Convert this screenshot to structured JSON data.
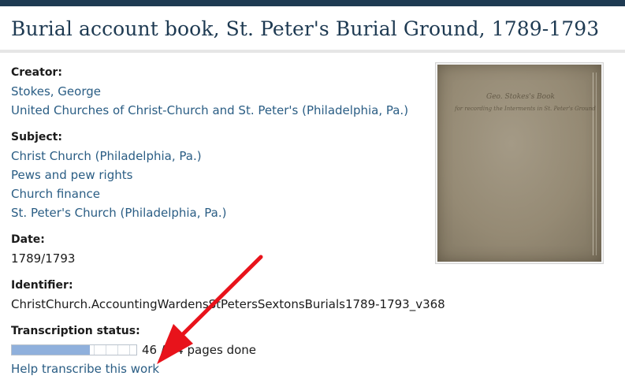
{
  "title": "Burial account book, St. Peter's Burial Ground, 1789-1793",
  "metadata": {
    "creator": {
      "label": "Creator:",
      "items": [
        "Stokes, George",
        "United Churches of Christ-Church and St. Peter's (Philadelphia, Pa.)"
      ]
    },
    "subject": {
      "label": "Subject:",
      "items": [
        "Christ Church (Philadelphia, Pa.)",
        "Pews and pew rights",
        "Church finance",
        "St. Peter's Church (Philadelphia, Pa.)"
      ]
    },
    "date": {
      "label": "Date:",
      "value": "1789/1793"
    },
    "identifier": {
      "label": "Identifier:",
      "value": "ChristChurch.AccountingWardensStPetersSextonsBurials1789-1793_v368"
    },
    "transcription": {
      "label": "Transcription status:",
      "progress_fraction": 0.625,
      "progress_text": "46 / 74 pages done",
      "help_link": "Help transcribe this work"
    }
  },
  "thumbnail": {
    "alt": "Cover of burial account book",
    "script_line1": "Geo. Stokes's Book",
    "script_line2": "for recording the Interments in St. Peter's Ground"
  },
  "colors": {
    "header_bar": "#1e3a52",
    "title": "#1e3a52",
    "link": "#2a5d84",
    "progress_fill": "#8fb0dc",
    "annotation_arrow": "#e8131b"
  }
}
